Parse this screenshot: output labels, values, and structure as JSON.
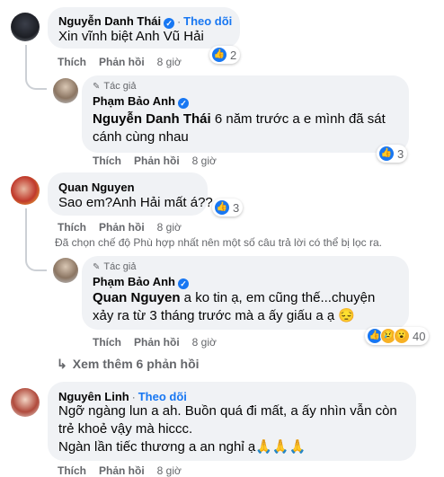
{
  "comments": [
    {
      "author": "Nguyễn Danh Thái",
      "follow_label": "Theo dõi",
      "text": "Xin vĩnh biệt Anh Vũ Hải",
      "like_label": "Thích",
      "reply_label": "Phản hồi",
      "time": "8 giờ",
      "reaction_count": "2"
    },
    {
      "author_tag": "Tác giả",
      "author": "Phạm Bảo Anh",
      "mention": "Nguyễn Danh Thái",
      "text_line1": " 6 năm trước a e mình đã sát",
      "text_line2": "cánh cùng nhau",
      "like_label": "Thích",
      "reply_label": "Phản hồi",
      "time": "8 giờ",
      "reaction_count": "3"
    },
    {
      "author": "Quan Nguyen",
      "text": "Sao em?Anh Hải mất á??",
      "like_label": "Thích",
      "reply_label": "Phản hồi",
      "time": "8 giờ",
      "reaction_count": "3"
    },
    {
      "author_tag": "Tác giả",
      "author": "Phạm Bảo Anh",
      "mention": "Quan Nguyen",
      "text_line1": " a ko tin ạ, em cũng thế...chuyện",
      "text_line2": "xảy ra từ 3 tháng trước mà a ấy giấu a ạ 😔",
      "like_label": "Thích",
      "reply_label": "Phản hồi",
      "time": "8 giờ",
      "reaction_count": "40"
    },
    {
      "author": "Nguyên Linh",
      "follow_label": "Theo dõi",
      "text_line1": "Ngỡ ngàng lun a ah. Buồn quá đi mất, a ấy nhìn vẫn còn",
      "text_line2": "trẻ khoẻ vậy mà hiccc.",
      "text_line3": "Ngàn lần tiếc thương a an nghỉ ạ🙏🙏🙏",
      "like_label": "Thích",
      "reply_label": "Phản hồi",
      "time": "8 giờ"
    }
  ],
  "filter_note": "Đã chọn chế độ Phù hợp nhất nên một số câu trả lời có thể bị lọc ra.",
  "see_more": "Xem thêm 6 phản hồi",
  "colors": {
    "accent": "#1877f2",
    "bubble": "#f0f2f5",
    "meta": "#65676b"
  }
}
